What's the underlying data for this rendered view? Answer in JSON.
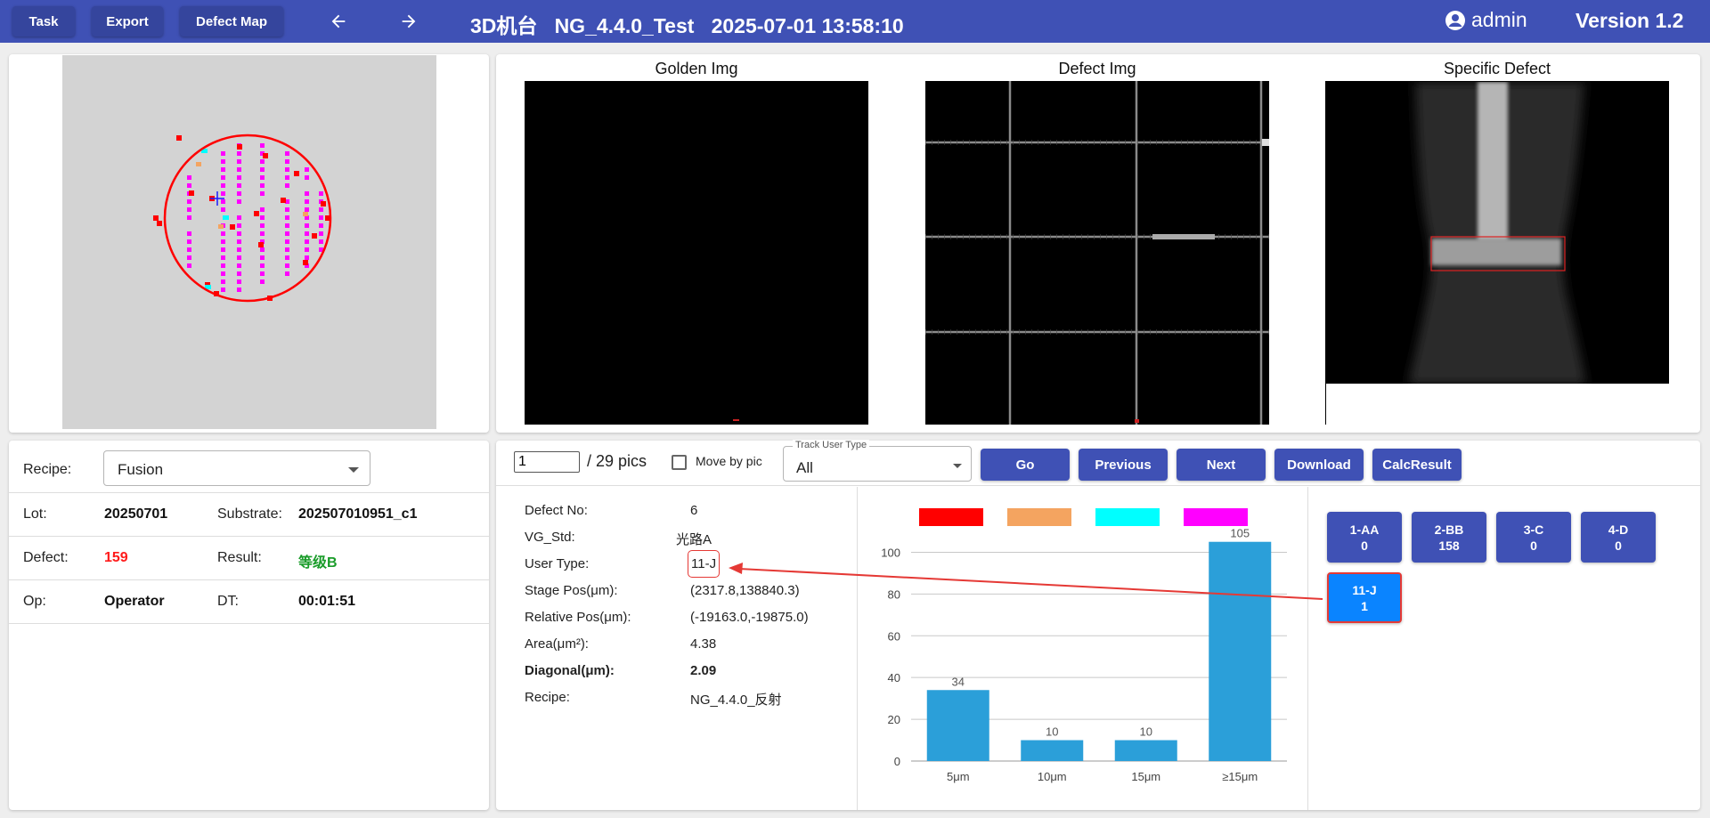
{
  "toolbar": {
    "task": "Task",
    "export": "Export",
    "defect_map": "Defect Map",
    "title": "3D机台   NG_4.4.0_Test   2025-07-01 13:58:10",
    "user": "admin",
    "version": "Version 1.2"
  },
  "images": {
    "golden": "Golden Img",
    "defect": "Defect Img",
    "specific": "Specific Defect"
  },
  "info": {
    "recipe_label": "Recipe:",
    "recipe_value": "Fusion",
    "lot_label": "Lot:",
    "lot_value": "20250701",
    "substrate_label": "Substrate:",
    "substrate_value": "202507010951_c1",
    "defect_label": "Defect:",
    "defect_value": "159",
    "result_label": "Result:",
    "result_value": "等级B",
    "op_label": "Op:",
    "op_value": "Operator",
    "dt_label": "DT:",
    "dt_value": "00:01:51"
  },
  "controls": {
    "page_value": "1",
    "pics_text": "/ 29 pics",
    "move_by_pic": "Move by pic",
    "track_legend": "Track User Type",
    "track_value": "All",
    "go": "Go",
    "previous": "Previous",
    "next": "Next",
    "download": "Download",
    "calc_result": "CalcResult"
  },
  "details": {
    "defect_no_label": "Defect No:",
    "defect_no": "6",
    "vg_std_label": "VG_Std:",
    "vg_std": "光路A",
    "user_type_label": "User Type:",
    "user_type": "11-J",
    "stage_pos_label": "Stage Pos(μm):",
    "stage_pos": "(2317.8,138840.3)",
    "relative_pos_label": "Relative Pos(μm):",
    "relative_pos": "(-19163.0,-19875.0)",
    "area_label": "Area(μm²):",
    "area": "4.38",
    "diagonal_label": "Diagonal(μm):",
    "diagonal": "2.09",
    "recipe_label": "Recipe:",
    "recipe": "NG_4.4.0_反射"
  },
  "colors": {
    "legend": [
      "#ff0000",
      "#f4a460",
      "#00ffff",
      "#ff00ff"
    ],
    "bar": "#2b9fd9",
    "accent": "#3f51b5",
    "selected": "#0a84ff"
  },
  "chart_data": {
    "type": "bar",
    "categories": [
      "5μm",
      "10μm",
      "15μm",
      "≥15μm"
    ],
    "values": [
      34,
      10,
      10,
      105
    ],
    "yticks": [
      "0",
      "20",
      "40",
      "60",
      "80",
      "100"
    ],
    "ylim": [
      0,
      110
    ]
  },
  "user_types": [
    {
      "name": "1-AA",
      "count": "0"
    },
    {
      "name": "2-BB",
      "count": "158"
    },
    {
      "name": "3-C",
      "count": "0"
    },
    {
      "name": "4-D",
      "count": "0"
    },
    {
      "name": "11-J",
      "count": "1"
    }
  ]
}
